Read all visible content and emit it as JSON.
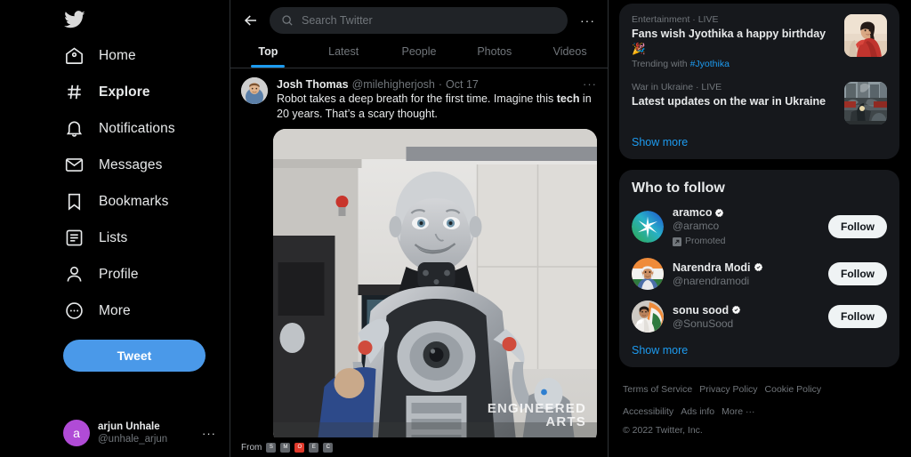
{
  "sidebar": {
    "logo_icon": "twitter-bird-icon",
    "items": [
      {
        "label": "Home",
        "icon": "home-icon",
        "active": false
      },
      {
        "label": "Explore",
        "icon": "hashtag-icon",
        "active": true
      },
      {
        "label": "Notifications",
        "icon": "bell-icon",
        "active": false
      },
      {
        "label": "Messages",
        "icon": "envelope-icon",
        "active": false
      },
      {
        "label": "Bookmarks",
        "icon": "bookmark-icon",
        "active": false
      },
      {
        "label": "Lists",
        "icon": "list-icon",
        "active": false
      },
      {
        "label": "Profile",
        "icon": "person-icon",
        "active": false
      },
      {
        "label": "More",
        "icon": "more-circle-icon",
        "active": false
      }
    ],
    "tweet_button": "Tweet",
    "account": {
      "name": "arjun Unhale",
      "handle": "@unhale_arjun",
      "avatar_letter": "a",
      "avatar_color": "#b04bd6",
      "more_dots": "···"
    }
  },
  "topbar": {
    "back_icon": "back-arrow-icon",
    "search_placeholder": "Search Twitter",
    "search_value": "",
    "more_dots": "···"
  },
  "tabs": [
    {
      "label": "Top",
      "active": true
    },
    {
      "label": "Latest",
      "active": false
    },
    {
      "label": "People",
      "active": false
    },
    {
      "label": "Photos",
      "active": false
    },
    {
      "label": "Videos",
      "active": false
    }
  ],
  "tweet": {
    "author_name": "Josh Thomas",
    "author_handle": "@milehigherjosh",
    "separator": "·",
    "date": "Oct 17",
    "more_dots": "···",
    "text_part1": "Robot takes a deep breath for the first time. Imagine this ",
    "text_bold": "tech",
    "text_part2": " in 20 years. That’s a scary thought.",
    "media_alt": "humanoid-robot-video",
    "watermark_line1": "ENGINEERED",
    "watermark_line2": "ARTS"
  },
  "from_bar": {
    "label": "From",
    "badges": [
      "S",
      "M",
      "O",
      "E",
      "C"
    ],
    "active_index": 2
  },
  "trends": {
    "items": [
      {
        "category": "Entertainment · LIVE",
        "title": "Fans wish Jyothika a happy birthday 🎉",
        "trending_with_prefix": "Trending with ",
        "trending_with_tag": "#Jyothika",
        "thumb": "woman-in-red-saree-photo"
      },
      {
        "category": "War in Ukraine · LIVE",
        "title": "Latest updates on the war in Ukraine",
        "trending_with_prefix": "",
        "trending_with_tag": "",
        "thumb": "war-damage-street-photo"
      }
    ],
    "show_more": "Show more"
  },
  "who_to_follow": {
    "title": "Who to follow",
    "accounts": [
      {
        "name": "aramco",
        "handle": "@aramco",
        "verified": true,
        "promoted": "Promoted",
        "follow_label": "Follow",
        "avatar": "aramco-logo-avatar"
      },
      {
        "name": "Narendra Modi",
        "handle": "@narendramodi",
        "verified": true,
        "promoted": "",
        "follow_label": "Follow",
        "avatar": "narendra-modi-avatar"
      },
      {
        "name": "sonu sood",
        "handle": "@SonuSood",
        "verified": true,
        "promoted": "",
        "follow_label": "Follow",
        "avatar": "sonu-sood-avatar"
      }
    ],
    "show_more": "Show more"
  },
  "footer": {
    "links": [
      "Terms of Service",
      "Privacy Policy",
      "Cookie Policy",
      "Accessibility",
      "Ads info",
      "More ···"
    ],
    "copyright": "© 2022 Twitter, Inc."
  },
  "colors": {
    "accent": "#1d9bf0",
    "tweet_button": "#4a99e9",
    "card_bg": "#16181c",
    "page_bg": "#000000",
    "text_primary": "#e7e9ea",
    "text_muted": "#71767b",
    "border": "#2f3336",
    "follow_bg": "#eff3f4"
  }
}
